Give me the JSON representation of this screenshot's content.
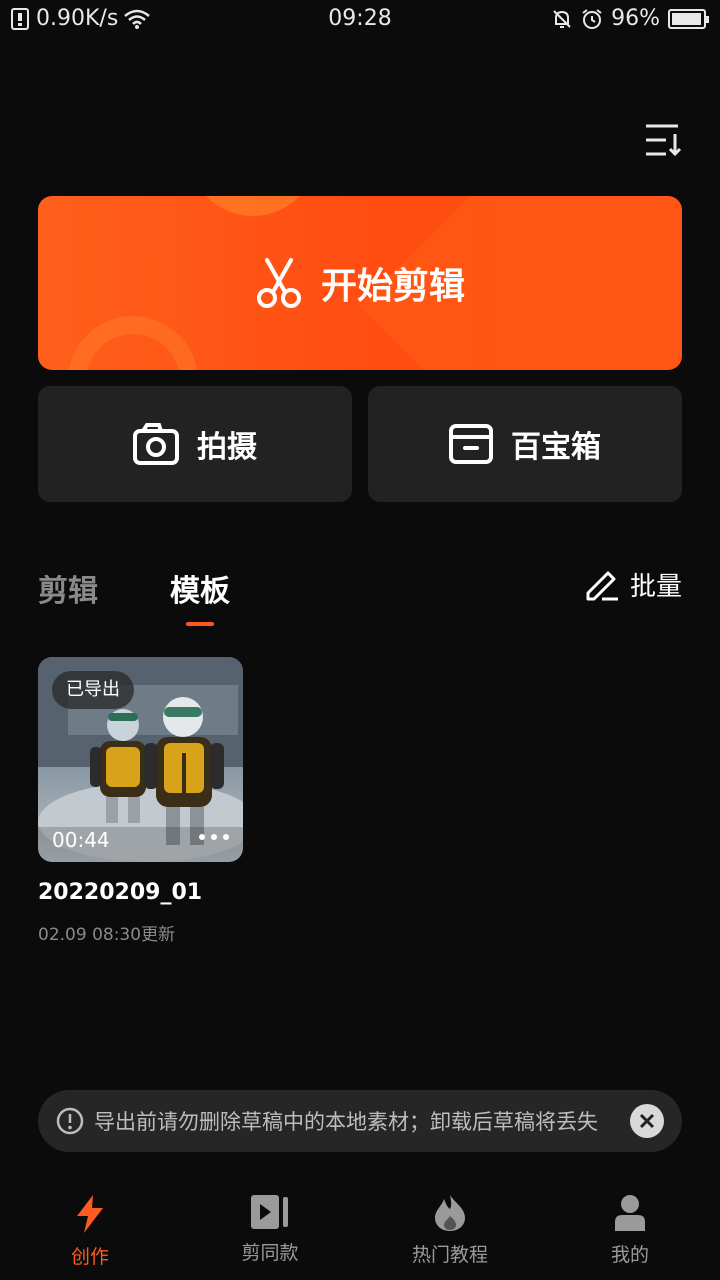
{
  "status_bar": {
    "network_speed": "0.90K/s",
    "time": "09:28",
    "battery": "96%",
    "battery_level": 0.96
  },
  "main": {
    "start_edit_label": "开始剪辑",
    "shoot_label": "拍摄",
    "toolbox_label": "百宝箱"
  },
  "tabs": {
    "edit": "剪辑",
    "template": "模板",
    "batch": "批量"
  },
  "draft": {
    "badge": "已导出",
    "duration": "00:44",
    "title": "20220209_01",
    "updated": "02.09 08:30更新"
  },
  "notice": {
    "text": "导出前请勿删除草稿中的本地素材；卸载后草稿将丢失"
  },
  "nav": {
    "items": [
      {
        "label": "创作",
        "icon": "lightning-icon",
        "active": true
      },
      {
        "label": "剪同款",
        "icon": "video-play-icon",
        "active": false
      },
      {
        "label": "热门教程",
        "icon": "flame-icon",
        "active": false
      },
      {
        "label": "我的",
        "icon": "person-icon",
        "active": false
      }
    ]
  },
  "colors": {
    "accent": "#ff5a1f",
    "background": "#0b0b0b",
    "card": "#222222"
  }
}
